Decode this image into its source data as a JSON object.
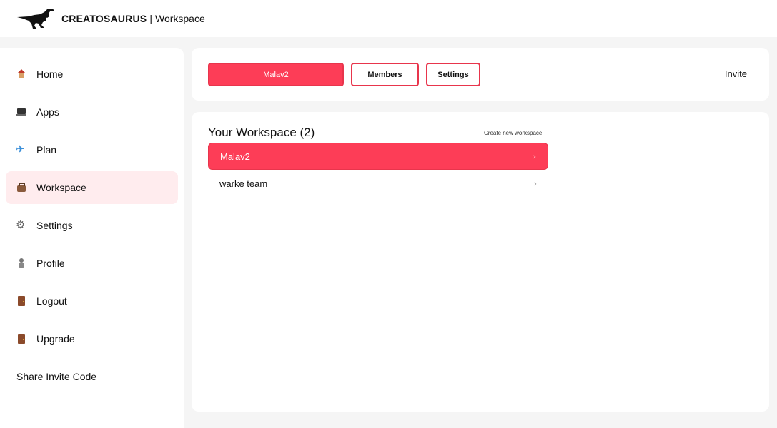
{
  "header": {
    "brand": "CREATOSAURUS",
    "separator": "|",
    "section": "Workspace"
  },
  "sidebar": {
    "items": [
      {
        "label": "Home",
        "icon": "home-icon"
      },
      {
        "label": "Apps",
        "icon": "laptop-icon"
      },
      {
        "label": "Plan",
        "icon": "airplane-icon"
      },
      {
        "label": "Workspace",
        "icon": "briefcase-icon",
        "active": true
      },
      {
        "label": "Settings",
        "icon": "gear-icon"
      },
      {
        "label": "Profile",
        "icon": "profile-icon"
      },
      {
        "label": "Logout",
        "icon": "door-icon"
      },
      {
        "label": "Upgrade",
        "icon": "door-icon"
      },
      {
        "label": "Share Invite Code"
      }
    ]
  },
  "topbar": {
    "workspace_button": "Malav2",
    "members_button": "Members",
    "settings_button": "Settings",
    "invite": "Invite"
  },
  "main": {
    "title": "Your Workspace (2)",
    "create_link": "Create new workspace",
    "workspaces": [
      {
        "name": "Malav2",
        "active": true
      },
      {
        "name": "warke team",
        "active": false
      }
    ],
    "chevron": "›"
  },
  "colors": {
    "accent": "#fd3d57",
    "active_bg": "#ffecee",
    "page_bg": "#f5f5f5"
  }
}
